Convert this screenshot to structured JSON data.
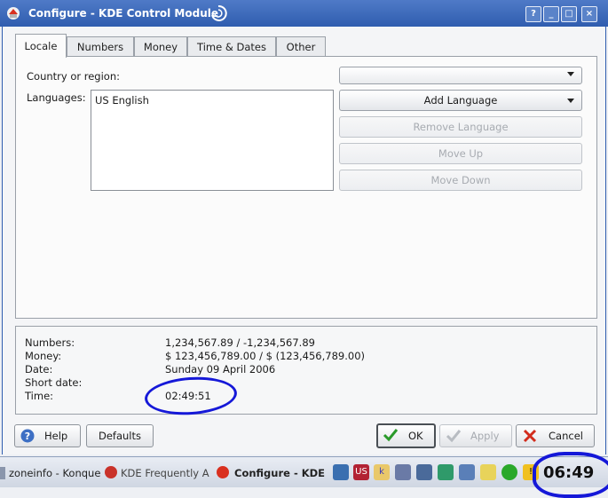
{
  "window": {
    "title": "Configure - KDE Control Module",
    "buttons": [
      "?",
      "_",
      "□",
      "×"
    ]
  },
  "tabs": [
    "Locale",
    "Numbers",
    "Money",
    "Time & Dates",
    "Other"
  ],
  "locale": {
    "country_label": "Country or region:",
    "country_value": "",
    "languages_label": "Languages:",
    "languages": [
      "US English"
    ],
    "add_language": "Add Language",
    "remove_language": "Remove Language",
    "move_up": "Move Up",
    "move_down": "Move Down"
  },
  "example": {
    "numbers_label": "Numbers:",
    "numbers_value": "1,234,567.89 / -1,234,567.89",
    "money_label": "Money:",
    "money_value": "$ 123,456,789.00 / $ (123,456,789.00)",
    "date_label": "Date:",
    "date_value": "Sunday 09 April 2006",
    "short_date_label": "Short date:",
    "short_date_value": "",
    "time_label": "Time:",
    "time_value": "02:49:51"
  },
  "buttons": {
    "help": "Help",
    "defaults": "Defaults",
    "ok": "OK",
    "apply": "Apply",
    "cancel": "Cancel"
  },
  "taskbar": {
    "tasks": [
      "zoneinfo - Konque",
      "KDE Frequently A",
      "Configure - KDE"
    ],
    "clock": "06:49",
    "tray": [
      "network-icon",
      "keyboard-layout-flag-icon",
      "klipper-icon",
      "printer-icon",
      "volume-icon",
      "puzzle-icon",
      "wrench-icon",
      "note-icon",
      "clover-icon",
      "warning-icon"
    ],
    "keyboard_layout": "US"
  },
  "colors": {
    "titlebar": "#2f5daf",
    "annotation": "#1518d8",
    "ok_check": "#2a9a2a",
    "cancel_x": "#d22c1c",
    "help_icon": "#3d6fc4"
  }
}
